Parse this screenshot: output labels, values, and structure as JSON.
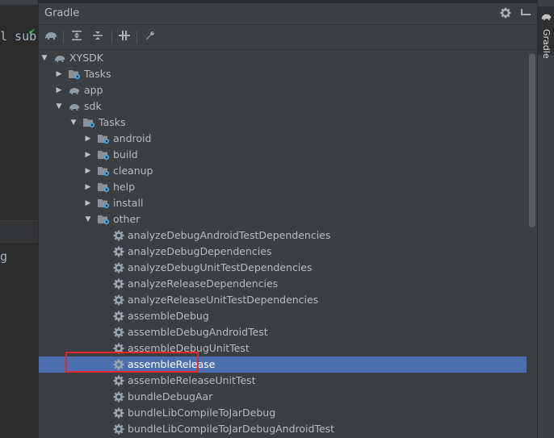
{
  "panel": {
    "title": "Gradle",
    "settings_icon": "gear-icon",
    "hide_icon": "hide-panel-icon",
    "side_tab_label": "Gradle"
  },
  "editor": {
    "line1": "l sub",
    "line2": "g"
  },
  "toolbar": {
    "icons": [
      "gradle-elephant-icon",
      "expand-all-icon",
      "collapse-all-icon",
      "toggle-offline-icon",
      "wrench-icon"
    ]
  },
  "tree": [
    {
      "label": "XYSDK",
      "depth": 0,
      "expanded": true,
      "kind": "project"
    },
    {
      "label": "Tasks",
      "depth": 1,
      "expanded": false,
      "kind": "folder"
    },
    {
      "label": "app",
      "depth": 1,
      "expanded": false,
      "kind": "module"
    },
    {
      "label": "sdk",
      "depth": 1,
      "expanded": true,
      "kind": "module"
    },
    {
      "label": "Tasks",
      "depth": 2,
      "expanded": true,
      "kind": "folder"
    },
    {
      "label": "android",
      "depth": 3,
      "expanded": false,
      "kind": "folder"
    },
    {
      "label": "build",
      "depth": 3,
      "expanded": false,
      "kind": "folder"
    },
    {
      "label": "cleanup",
      "depth": 3,
      "expanded": false,
      "kind": "folder"
    },
    {
      "label": "help",
      "depth": 3,
      "expanded": false,
      "kind": "folder"
    },
    {
      "label": "install",
      "depth": 3,
      "expanded": false,
      "kind": "folder"
    },
    {
      "label": "other",
      "depth": 3,
      "expanded": true,
      "kind": "folder"
    },
    {
      "label": "analyzeDebugAndroidTestDependencies",
      "depth": 4,
      "kind": "task"
    },
    {
      "label": "analyzeDebugDependencies",
      "depth": 4,
      "kind": "task"
    },
    {
      "label": "analyzeDebugUnitTestDependencies",
      "depth": 4,
      "kind": "task"
    },
    {
      "label": "analyzeReleaseDependencies",
      "depth": 4,
      "kind": "task"
    },
    {
      "label": "analyzeReleaseUnitTestDependencies",
      "depth": 4,
      "kind": "task"
    },
    {
      "label": "assembleDebug",
      "depth": 4,
      "kind": "task"
    },
    {
      "label": "assembleDebugAndroidTest",
      "depth": 4,
      "kind": "task"
    },
    {
      "label": "assembleDebugUnitTest",
      "depth": 4,
      "kind": "task"
    },
    {
      "label": "assembleRelease",
      "depth": 4,
      "kind": "task",
      "selected": true
    },
    {
      "label": "assembleReleaseUnitTest",
      "depth": 4,
      "kind": "task"
    },
    {
      "label": "bundleDebugAar",
      "depth": 4,
      "kind": "task"
    },
    {
      "label": "bundleLibCompileToJarDebug",
      "depth": 4,
      "kind": "task"
    },
    {
      "label": "bundleLibCompileToJarDebugAndroidTest",
      "depth": 4,
      "kind": "task"
    }
  ],
  "colors": {
    "selection": "#4b6eaf",
    "highlight_box": "#e3262b",
    "task_gear": "#9aa4ad",
    "folder_badge": "#4aa0d8"
  }
}
